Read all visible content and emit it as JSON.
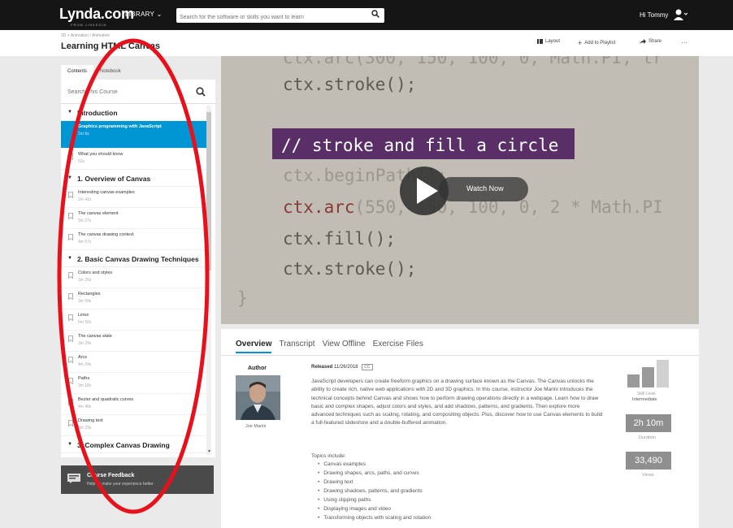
{
  "topnav": {
    "logo": "Lynda.com",
    "logo_sub": "FROM LINKEDIN",
    "library": "LIBRARY ⌄",
    "search_placeholder": "Search for the software or skills you want to learn",
    "greeting": "Hi Tommy"
  },
  "header": {
    "breadcrumb": "3D + Animation  /  Animation",
    "title": "Learning HTML Canvas",
    "actions": {
      "layout": "Layout",
      "add_playlist": "Add to Playlist",
      "share": "Share",
      "more": "···"
    }
  },
  "sidebar": {
    "tabs": [
      "Contents",
      "Notebook"
    ],
    "search_placeholder": "Search This Course",
    "toc": [
      {
        "type": "chapter",
        "title": "Introduction"
      },
      {
        "type": "lesson",
        "title": "Graphics programming with JavaScript",
        "duration": "1m 6s",
        "active": true
      },
      {
        "type": "lesson",
        "title": "What you should know",
        "duration": "52s"
      },
      {
        "type": "chapter",
        "title": "1. Overview of Canvas"
      },
      {
        "type": "lesson",
        "title": "Interesting canvas examples",
        "duration": "2m 41s"
      },
      {
        "type": "lesson",
        "title": "The canvas element",
        "duration": "5m 27s"
      },
      {
        "type": "lesson",
        "title": "The canvas drawing context",
        "duration": "4m 57s"
      },
      {
        "type": "chapter",
        "title": "2. Basic Canvas Drawing Techniques"
      },
      {
        "type": "lesson",
        "title": "Colors and styles",
        "duration": "3m 25s"
      },
      {
        "type": "lesson",
        "title": "Rectangles",
        "duration": "3m 59s"
      },
      {
        "type": "lesson",
        "title": "Lines",
        "duration": "6m 50s"
      },
      {
        "type": "lesson",
        "title": "The canvas state",
        "duration": "3m 29s"
      },
      {
        "type": "lesson",
        "title": "Arcs",
        "duration": "4m 24s"
      },
      {
        "type": "lesson",
        "title": "Paths",
        "duration": "3m 18s"
      },
      {
        "type": "lesson",
        "title": "Bezier and quadratic curves",
        "duration": "4m 48s"
      },
      {
        "type": "lesson",
        "title": "Drawing text",
        "duration": "6m 23s"
      },
      {
        "type": "chapter",
        "title": "3. Complex Canvas Drawing"
      }
    ],
    "feedback": {
      "title": "Course Feedback",
      "subtitle": "Help us make your experience better"
    }
  },
  "video": {
    "line0": "ctx.arc(300, 150, 100, 0, Math.PI, tr",
    "line1": "ctx.stroke();",
    "highlight": "// stroke and fill a circle",
    "line3": "ctx.beginPath();",
    "line4_kw": "ctx.arc",
    "line4_rest": "(550, 150, 100, 0, 2 * Math.PI",
    "line5": "ctx.fill();",
    "line6": "ctx.stroke();",
    "brace": "}",
    "watch_now": "Watch Now"
  },
  "overview": {
    "tabs": [
      "Overview",
      "Transcript",
      "View Offline",
      "Exercise Files"
    ],
    "author_label": "Author",
    "author_name": "Joe Marini",
    "released_label": "Released",
    "released_date": "11/26/2018",
    "cc": "CC",
    "description": "JavaScript developers can create freeform graphics on a drawing surface known as the Canvas. The Canvas unlocks the ability to create rich, native web applications with 2D and 3D graphics. In this course, instructor Joe Marini introduces the technical concepts behind Canvas and shows how to perform drawing operations directly in a webpage. Learn how to draw basic and complex shapes, adjust colors and styles, and add shadows, patterns, and gradients. Then explore more advanced techniques such as scaling, rotating, and compositing objects. Plus, discover how to use Canvas elements to build a full-featured slideshow and a double-buffered animation.",
    "topics_label": "Topics include:",
    "topics": [
      "Canvas examples",
      "Drawing shapes, arcs, paths, and curves",
      "Drawing text",
      "Drawing shadows, patterns, and gradients",
      "Using clipping paths",
      "Displaying images and video",
      "Transforming objects with scaling and rotation"
    ],
    "skill_label": "Skill Level",
    "skill_value": "Intermediate",
    "duration": "2h 10m",
    "duration_label": "Duration",
    "views": "33,490",
    "views_label": "Views"
  }
}
